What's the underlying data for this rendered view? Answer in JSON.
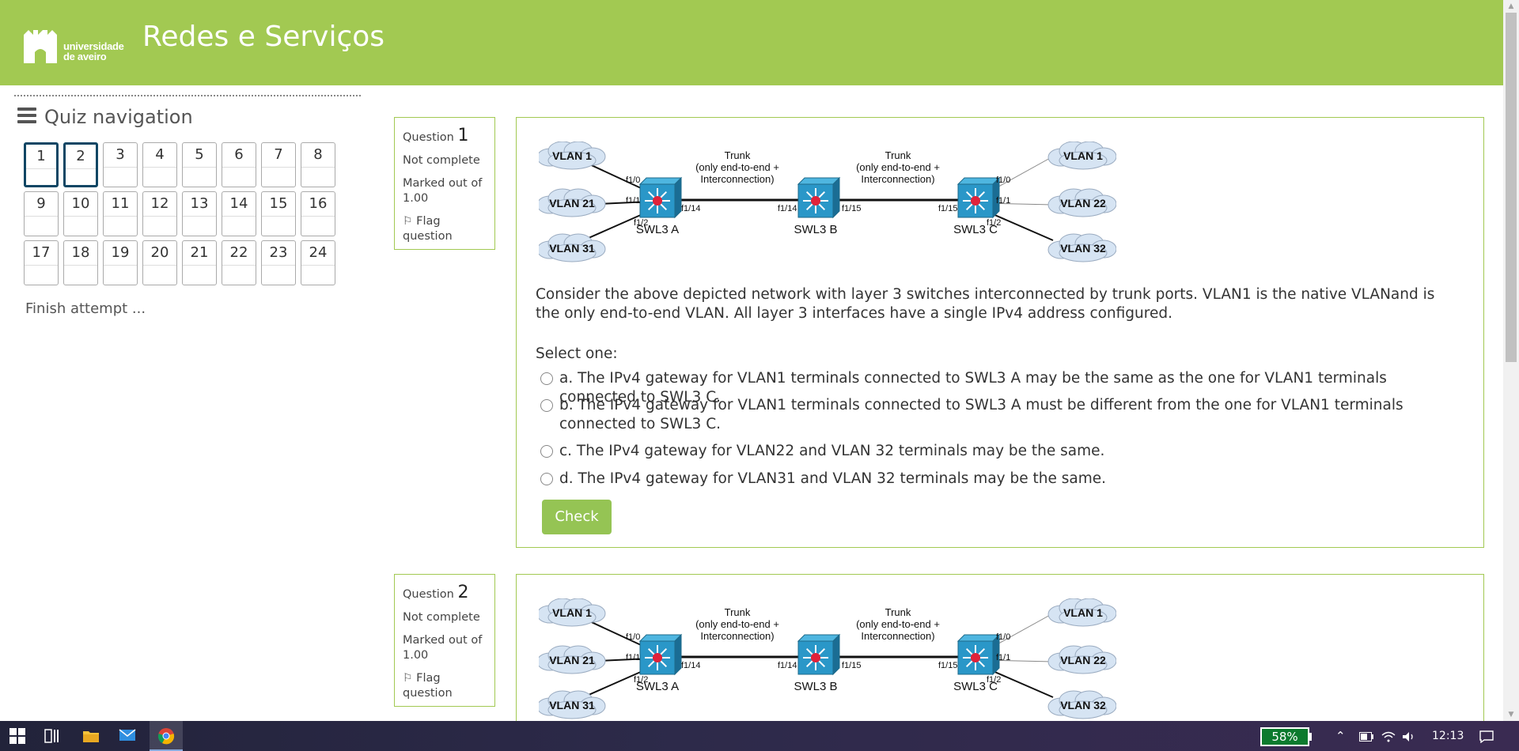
{
  "header": {
    "logo_line1": "universidade",
    "logo_line2": "de aveiro",
    "title": "Redes e Serviços",
    "bg_color": "#a2c952"
  },
  "nav": {
    "title": "Quiz navigation",
    "questions": [
      "1",
      "2",
      "3",
      "4",
      "5",
      "6",
      "7",
      "8",
      "9",
      "10",
      "11",
      "12",
      "13",
      "14",
      "15",
      "16",
      "17",
      "18",
      "19",
      "20",
      "21",
      "22",
      "23",
      "24"
    ],
    "current": [
      "1",
      "2"
    ],
    "finish_label": "Finish attempt ..."
  },
  "diagram": {
    "vlan_left": [
      "VLAN 1",
      "VLAN 21",
      "VLAN 31"
    ],
    "vlan_right": [
      "VLAN 1",
      "VLAN 22",
      "VLAN 32"
    ],
    "switches": [
      "SWL3 A",
      "SWL3 B",
      "SWL3 C"
    ],
    "trunk_label_1": "Trunk",
    "trunk_label_2": "(only end-to-end +",
    "trunk_label_3": "Interconnection)",
    "ports": {
      "a_f10": "f1/0",
      "a_f11": "f1/1",
      "a_f12": "f1/2",
      "a_f114": "f1/14",
      "b_f114": "f1/14",
      "b_f115": "f1/15",
      "c_f115": "f1/15",
      "c_f10": "f1/0",
      "c_f11": "f1/1",
      "c_f12": "f1/2"
    }
  },
  "q1": {
    "label": "Question",
    "number": "1",
    "status": "Not complete",
    "marked_line1": "Marked out of",
    "marked_line2": "1.00",
    "flag_line1": "Flag",
    "flag_line2": "question",
    "text": "Consider the above depicted network with layer 3 switches interconnected by trunk ports. VLAN1 is the native VLANand is the only end-to-end VLAN. All layer 3 interfaces have a single IPv4 address configured.",
    "prompt": "Select one:",
    "options": [
      "a. The IPv4 gateway for VLAN1 terminals connected to SWL3 A may be the same as the one for VLAN1 terminals connected to SWL3 C.",
      "b. The IPv4 gateway for VLAN1 terminals connected to SWL3 A must be different from the one for VLAN1 terminals connected to SWL3 C.",
      "c. The IPv4 gateway for VLAN22 and VLAN 32 terminals may be the same.",
      "d. The IPv4 gateway for VLAN31 and VLAN 32 terminals may be the same."
    ],
    "check_label": "Check"
  },
  "q2": {
    "label": "Question",
    "number": "2",
    "status": "Not complete",
    "marked_line1": "Marked out of",
    "marked_line2": "1.00",
    "flag_line1": "Flag",
    "flag_line2": "question"
  },
  "taskbar": {
    "battery": "58%",
    "time": "12:13"
  }
}
